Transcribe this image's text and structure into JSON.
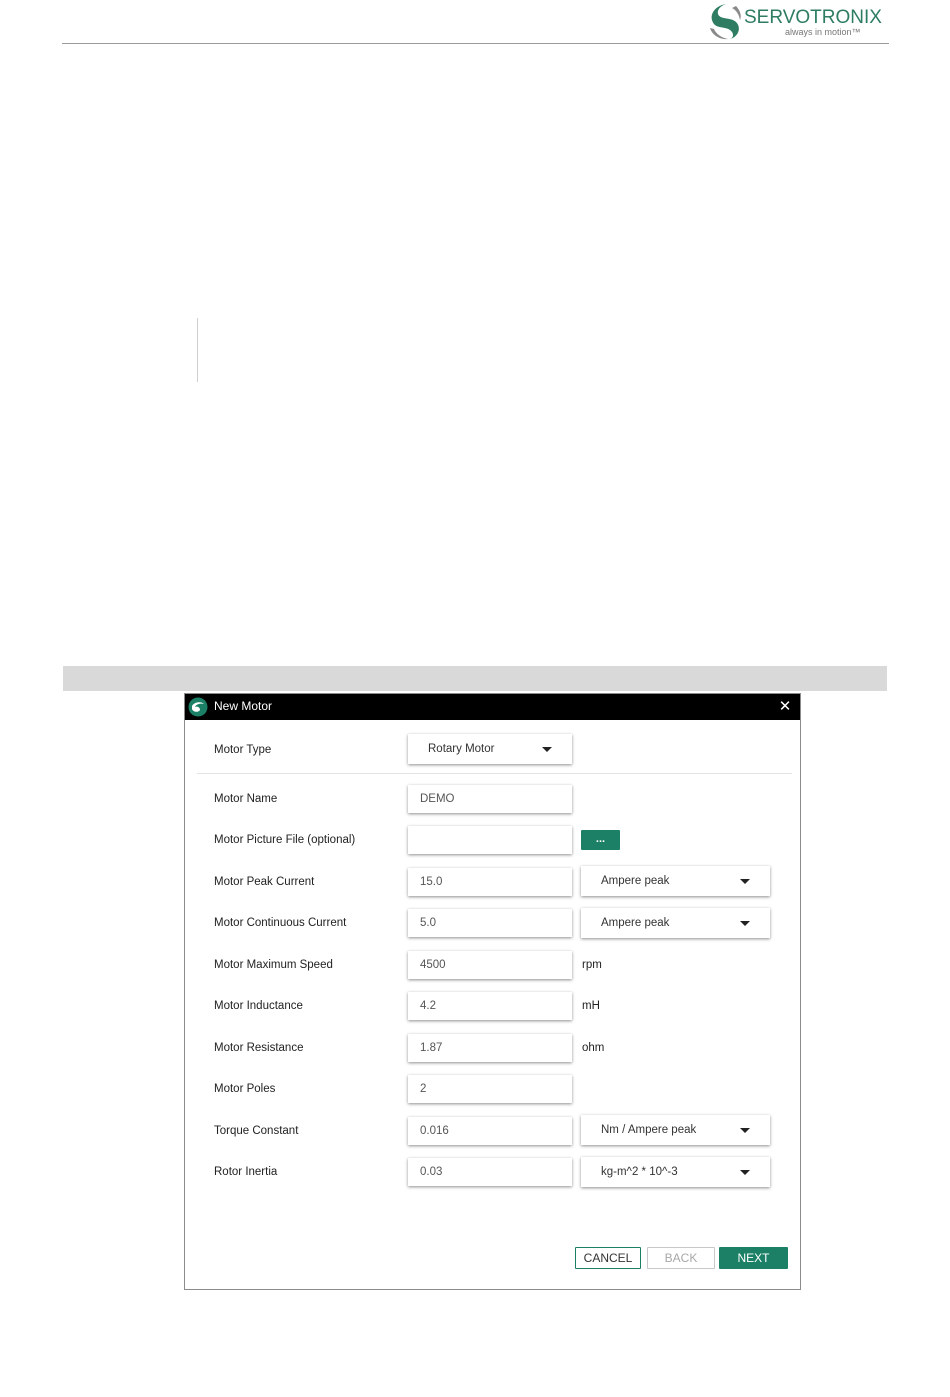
{
  "header": {
    "brand_name": "SERVOTRONIX",
    "brand_tagline": "always in motion™",
    "brand_color": "#2e7d62"
  },
  "dialog": {
    "title": "New Motor",
    "close_glyph": "✕",
    "accent_color": "#1b8066",
    "motor_type": {
      "label": "Motor Type",
      "value": "Rotary Motor"
    },
    "motor_name": {
      "label": "Motor Name",
      "value": "DEMO"
    },
    "motor_picture": {
      "label": "Motor Picture File (optional)",
      "value": "",
      "browse_label": "..."
    },
    "peak_current": {
      "label": "Motor Peak Current",
      "value": "15.0",
      "unit": "Ampere peak"
    },
    "continuous_current": {
      "label": "Motor Continuous Current",
      "value": "5.0",
      "unit": "Ampere peak"
    },
    "max_speed": {
      "label": "Motor Maximum Speed",
      "value": "4500",
      "unit": "rpm"
    },
    "inductance": {
      "label": "Motor Inductance",
      "value": "4.2",
      "unit": "mH"
    },
    "resistance": {
      "label": "Motor Resistance",
      "value": "1.87",
      "unit": "ohm"
    },
    "poles": {
      "label": "Motor Poles",
      "value": "2"
    },
    "torque_constant": {
      "label": "Torque Constant",
      "value": "0.016",
      "unit": "Nm / Ampere peak"
    },
    "rotor_inertia": {
      "label": "Rotor Inertia",
      "value": "0.03",
      "unit": "kg-m^2 * 10^-3"
    },
    "buttons": {
      "cancel": "CANCEL",
      "back": "BACK",
      "next": "NEXT"
    }
  }
}
